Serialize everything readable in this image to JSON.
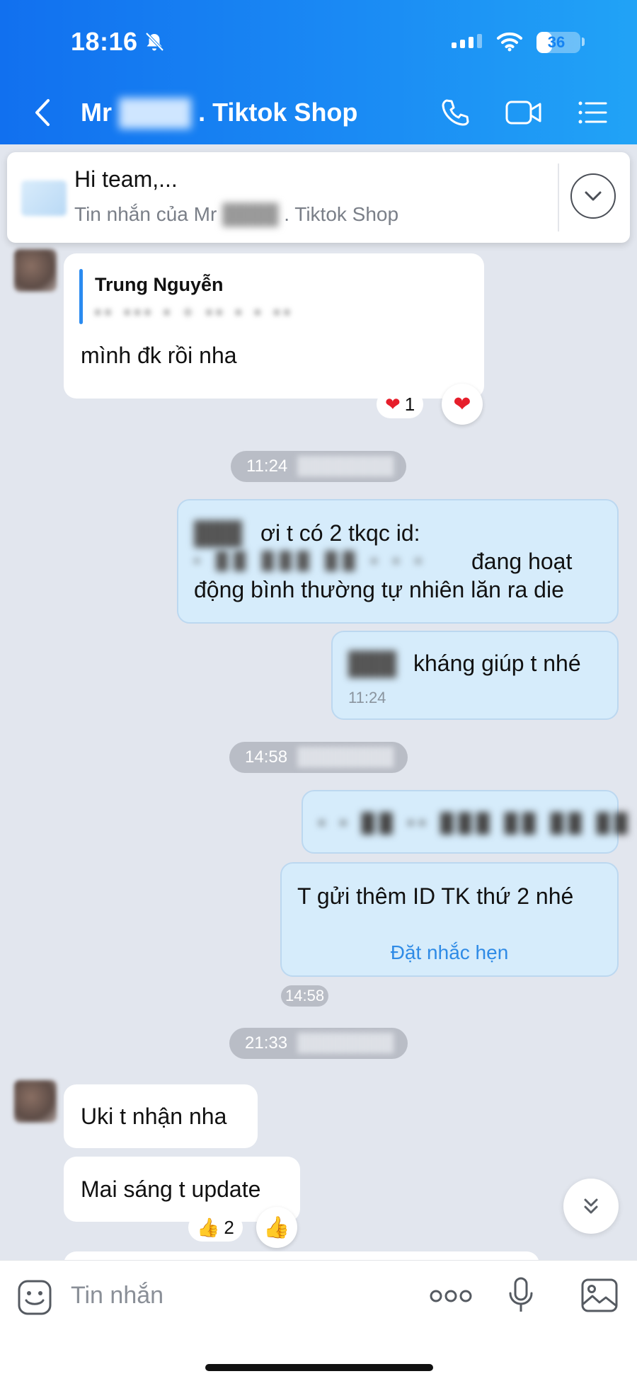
{
  "status_bar": {
    "time": "18:16",
    "battery": "36",
    "battery_level": 0.36
  },
  "header": {
    "title_prefix": "Mr",
    "title_hidden": "████",
    "title_suffix": ". Tiktok Shop"
  },
  "pinned": {
    "title": "Hi team,...",
    "subtitle_prefix": "Tin nhắn của Mr",
    "subtitle_hidden": "████",
    "subtitle_suffix": ". Tiktok Shop"
  },
  "messages": {
    "m1": {
      "reply_name": "Trung Nguyễn",
      "reply_hidden": "•• ••• • + •• • • ••",
      "text": "mình đk rồi nha",
      "reaction_count": "1"
    },
    "time1": {
      "time": "11:24",
      "hidden": "████████"
    },
    "m2": {
      "hidden_name": "███",
      "line1": "ơi t có 2 tkqc id:",
      "hidden_ids": "• ██ ███ ██ ▪ ▪ ▪",
      "line2": "đang hoạt",
      "line3": "động bình thường tự nhiên lăn ra die"
    },
    "m3": {
      "hidden_name": "███",
      "text": "kháng giúp t nhé",
      "time": "11:24"
    },
    "time2": {
      "time": "14:58",
      "hidden": "████████"
    },
    "m4": {
      "hidden_ids": "• • ██ •• ███ ██ ██ ██ •"
    },
    "m5": {
      "text": "T gửi thêm ID TK thứ 2 nhé",
      "reminder": "Đặt nhắc hẹn",
      "time": "14:58"
    },
    "time3": {
      "time": "21:33",
      "hidden": "████████"
    },
    "m6": {
      "text": "Uki t nhận nha"
    },
    "m7": {
      "text": "Mai sáng t update",
      "reaction_count": "2"
    }
  },
  "input": {
    "placeholder": "Tin nhắn"
  }
}
